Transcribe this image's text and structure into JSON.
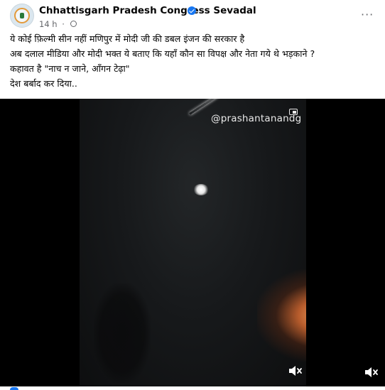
{
  "post": {
    "page_name": "Chhattisgarh Pradesh Congress Sevadal",
    "time": "14 h",
    "separator": "·",
    "caption_lines": [
      "ये कोई फ़िल्मी सीन नहीं मणिपुर में मोदी जी की डबल इंजन की सरकार है",
      "अब दलाल मीडिया और मोदी भक्त ये बताए कि यहाँ कौन सा विपक्ष और नेता गये थे भड़काने ?",
      "कहावत है \"नाच न जाने, आँगन टेढ़ा\"",
      "देश बर्बाद कर दिया.."
    ],
    "more_options": "···"
  },
  "video": {
    "watermark": "@prashantanandg"
  },
  "icons": {
    "verified": "verified-badge-icon",
    "privacy": "globe-icon",
    "more": "more-options-icon",
    "pip": "picture-in-picture-icon",
    "mute": "speaker-muted-icon"
  },
  "colors": {
    "verified_blue": "#1877f2",
    "meta_gray": "#65676b",
    "video_bg": "#000000"
  }
}
